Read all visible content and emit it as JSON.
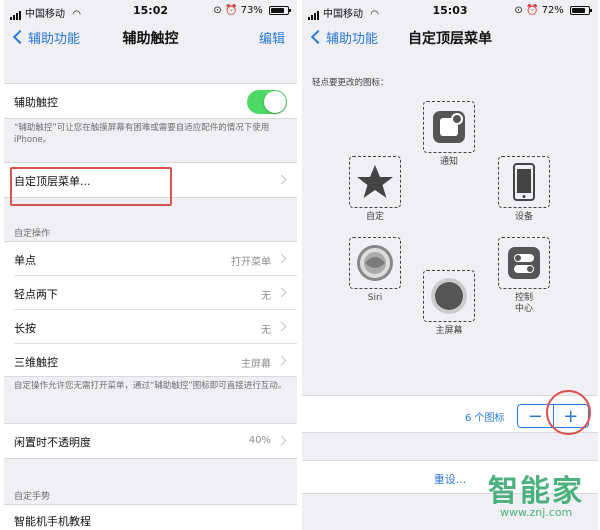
{
  "left": {
    "status": {
      "carrier": "中国移动",
      "time": "15:02",
      "battery": "73%",
      "battery_level": 0.73
    },
    "nav": {
      "back": "辅助功能",
      "title": "辅助触控",
      "edit": "编辑"
    },
    "assistive_touch": {
      "label": "辅助触控",
      "enabled": true
    },
    "assistive_note": "“辅助触控”可让您在触摸屏幕有困难或需要自适应配件的情况下使用 iPhone。",
    "custom_menu": "自定顶层菜单...",
    "custom_actions_header": "自定操作",
    "actions": [
      {
        "label": "单点",
        "value": "打开菜单"
      },
      {
        "label": "轻点两下",
        "value": "无"
      },
      {
        "label": "长按",
        "value": "无"
      },
      {
        "label": "三维触控",
        "value": "主屏幕"
      }
    ],
    "actions_note": "自定操作允许您无需打开菜单，通过“辅助触控”图标即可直接进行互动。",
    "idle_opacity": {
      "label": "闲置时不透明度",
      "value": "40%"
    },
    "gestures_header": "自定手势",
    "last_row": "智能机手机教程"
  },
  "right": {
    "status": {
      "carrier": "中国移动",
      "time": "15:03",
      "battery": "72%",
      "battery_level": 0.72
    },
    "nav": {
      "back": "辅助功能",
      "title": "自定顶层菜单"
    },
    "prompt": "轻点要更改的图标：",
    "icons": {
      "notification": "通知",
      "custom": "自定",
      "device": "设备",
      "siri": "Siri",
      "control_center": "控制\n中心",
      "home": "主屏幕"
    },
    "count_label": "6 个图标",
    "minus": "−",
    "plus": "+",
    "reset": "重设..."
  },
  "watermark": {
    "brand": "智能家",
    "url": "www.znj.com"
  },
  "colors": {
    "accent": "#2a78d8",
    "toggle_on": "#4cd964",
    "highlight": "#d9534f",
    "watermark": "#2fa56a"
  }
}
